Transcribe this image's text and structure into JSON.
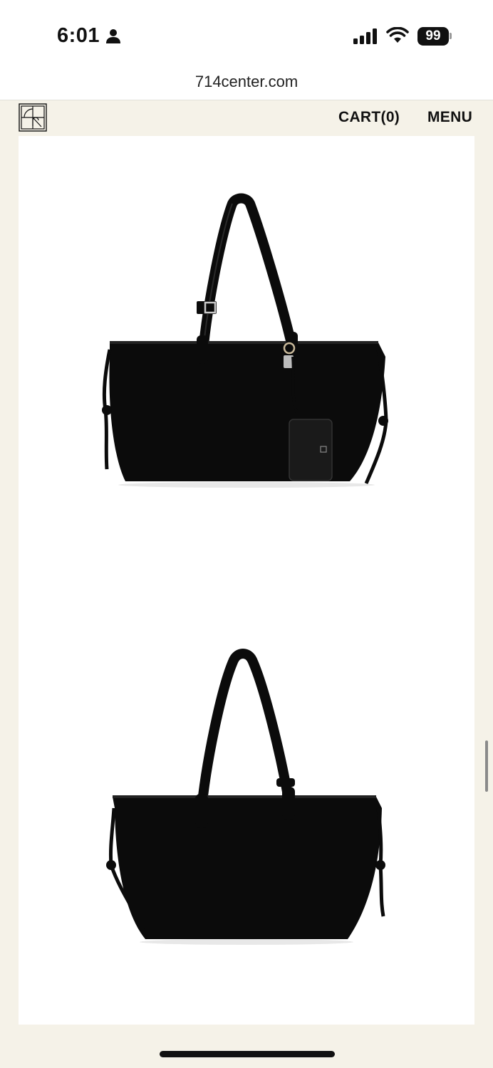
{
  "status_bar": {
    "time": "6:01",
    "battery": "99",
    "icons": [
      "person-icon",
      "signal-icon",
      "wifi-icon",
      "battery-icon"
    ]
  },
  "browser": {
    "url": "714center.com"
  },
  "header": {
    "logo_icon": "brand-logo-icon",
    "cart_label": "CART(0)",
    "menu_label": "MENU"
  },
  "gallery": {
    "images": [
      {
        "name": "tote-bag-front-with-pouch"
      },
      {
        "name": "tote-bag-back"
      }
    ]
  },
  "colors": {
    "page_background": "#f5f2e8",
    "bag": "#0b0b0b",
    "image_background": "#ffffff"
  }
}
